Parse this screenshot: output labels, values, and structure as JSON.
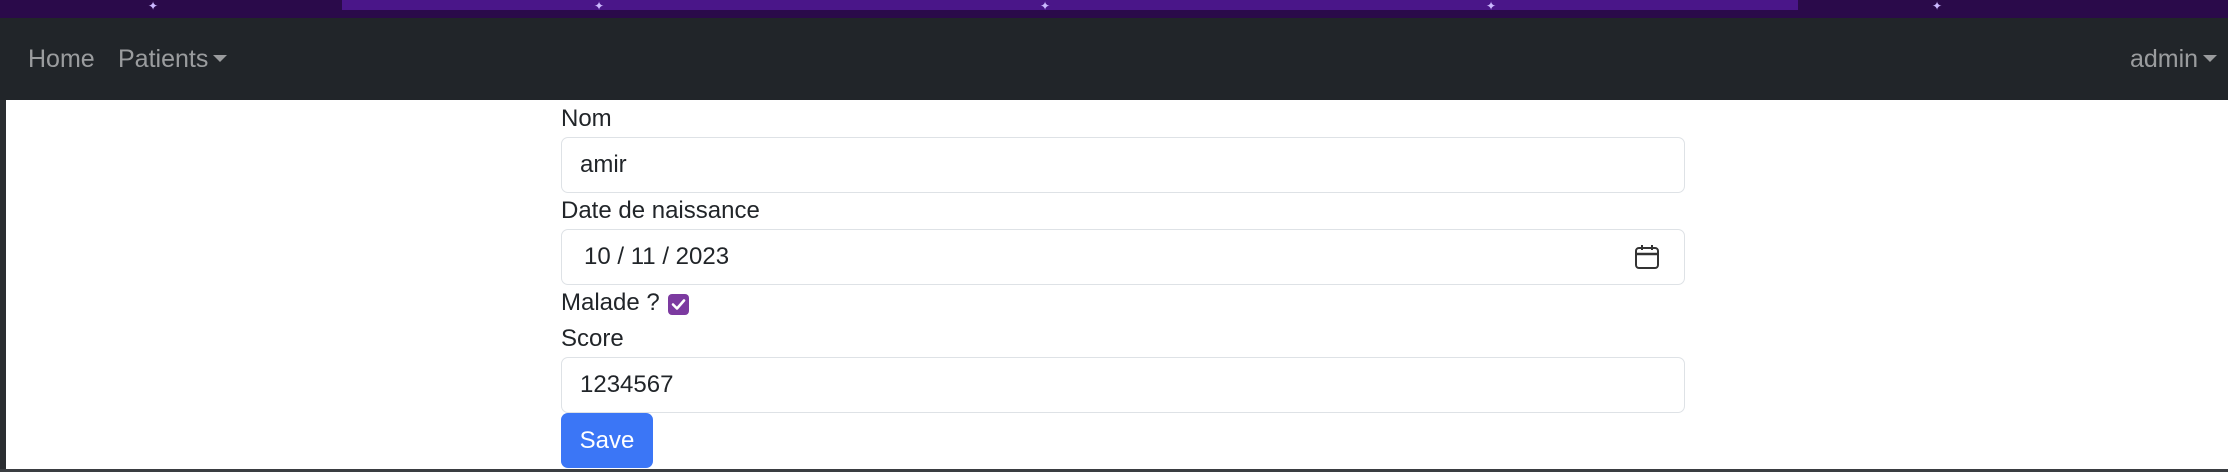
{
  "navbar": {
    "home_label": "Home",
    "patients_label": "Patients",
    "user_label": "admin"
  },
  "form": {
    "nom": {
      "label": "Nom",
      "value": "amir"
    },
    "date_naissance": {
      "label": "Date de naissance",
      "day": "10",
      "month": "11",
      "year": "2023",
      "separator": "/"
    },
    "malade": {
      "label": "Malade ?",
      "checked": true
    },
    "score": {
      "label": "Score",
      "value": "1234567"
    },
    "save_label": "Save"
  },
  "colors": {
    "navbar_bg": "#212529",
    "checkbox_accent": "#7c3aa0",
    "save_button": "#3b76f6"
  },
  "icons": [
    "calendar-icon",
    "chevron-down-icon",
    "check-icon"
  ]
}
